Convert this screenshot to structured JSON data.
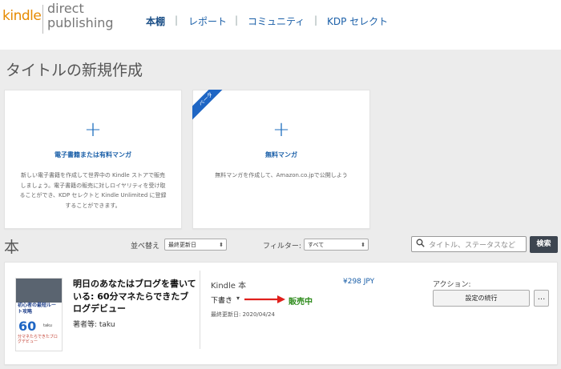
{
  "logo": {
    "kindle": "kindle",
    "direct": "direct",
    "publishing": "publishing"
  },
  "nav": {
    "items": [
      "本棚",
      "レポート",
      "コミュニティ",
      "KDP セレクト"
    ],
    "separator": "|"
  },
  "create": {
    "title": "タイトルの新規作成",
    "plus": "+",
    "ebook_card": {
      "title": "電子書籍または有料マンガ",
      "desc_lines": [
        "新しい電子書籍を作成して世界中の Kindle ストアで販売",
        "しましょう。電子書籍の販売に対しロイヤリティを受け取",
        "ることができ、KDP セレクトと Kindle Unlimited に登録",
        "することができます。"
      ]
    },
    "manga_card": {
      "ribbon": "ベータ",
      "title": "無料マンガ",
      "desc": "無料マンガを作成して、Amazon.co.jpで公開しよう"
    }
  },
  "books": {
    "heading": "本",
    "sort_label": "並べ替え",
    "sort_value": "最終更新日",
    "filter_label": "フィルター:",
    "filter_value": "すべて",
    "search_placeholder": "タイトル、ステータスなど",
    "search_button": "検索"
  },
  "book": {
    "title": "明日のあなたはブログを書いている: 60分マネたらできたブログデビュー",
    "author": "著者等: taku",
    "format": "Kindle 本",
    "price": "¥298 JPY",
    "draft_status": "下書き",
    "sale_status": "販売中",
    "updated": "最終更新日: 2020/04/24",
    "actions_label": "アクション:",
    "continue_button": "設定の続行",
    "more_button": "...",
    "cover": {
      "top_text": "初心者の最短ルート攻略",
      "big_number": "60",
      "tagline": "分マネたらできたブログデビュー",
      "author_tag": "taku"
    }
  },
  "colors": {
    "kindle_orange": "#e68a00",
    "link_blue": "#1a5fa8",
    "ribbon_blue": "#1f66c4",
    "status_green": "#2c8a1a",
    "arrow_red": "#e0201c",
    "search_button_bg": "#3d4550"
  },
  "icons": {
    "search": "magnifier-icon",
    "arrow": "red-arrow-right",
    "caret": "caret-down-icon",
    "plus": "plus-icon"
  }
}
